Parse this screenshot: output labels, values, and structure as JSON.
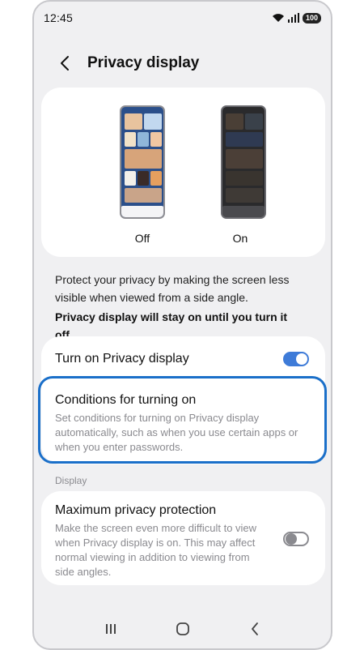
{
  "status": {
    "time": "12:45",
    "battery": "100"
  },
  "header": {
    "title": "Privacy display"
  },
  "preview": {
    "off_label": "Off",
    "on_label": "On"
  },
  "description": {
    "text": "Protect your privacy by making the screen less visible when viewed from a side angle.",
    "bold": "Privacy display will stay on until you turn it off."
  },
  "settings": {
    "turn_on": {
      "label": "Turn on Privacy display",
      "enabled": true
    },
    "conditions": {
      "title": "Conditions for turning on",
      "subtitle": "Set conditions for turning on Privacy display automatically, such as when you use certain apps or when you enter passwords."
    }
  },
  "display_section": {
    "header": "Display",
    "max_privacy": {
      "title": "Maximum privacy protection",
      "subtitle": "Make the screen even more difficult to view when Privacy display is on. This may affect normal viewing in addition to viewing from side angles.",
      "enabled": false
    }
  },
  "colors": {
    "accent": "#3e7bd8",
    "highlight": "#1a6fc9",
    "background": "#f0f0f2"
  }
}
